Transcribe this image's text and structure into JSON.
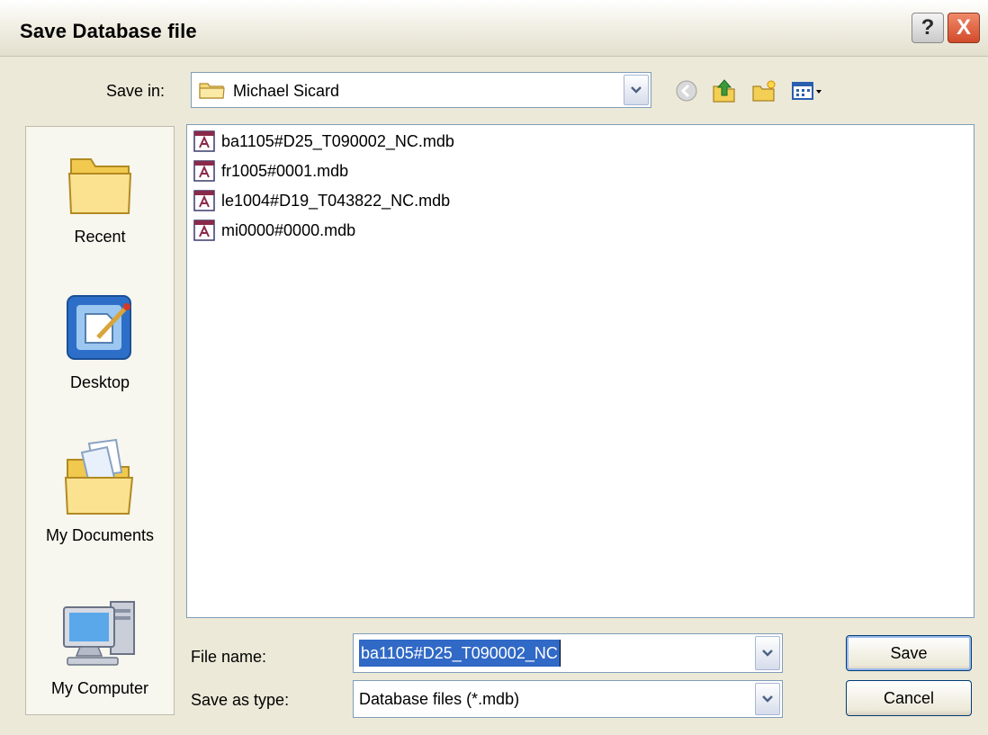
{
  "window": {
    "title": "Save Database file",
    "help_glyph": "?",
    "close_glyph": "X"
  },
  "save_in": {
    "label": "Save in:",
    "value": "Michael Sicard"
  },
  "toolbar": {
    "icons": [
      "back-icon",
      "up-folder-icon",
      "new-folder-icon",
      "views-menu-icon"
    ]
  },
  "places": [
    {
      "label": "Recent",
      "icon": "recent-folder-icon"
    },
    {
      "label": "Desktop",
      "icon": "desktop-icon"
    },
    {
      "label": "My Documents",
      "icon": "my-documents-icon"
    },
    {
      "label": "My Computer",
      "icon": "my-computer-icon"
    }
  ],
  "files": [
    {
      "name": "ba1105#D25_T090002_NC.mdb",
      "icon": "access-database-icon"
    },
    {
      "name": "fr1005#0001.mdb",
      "icon": "access-database-icon"
    },
    {
      "name": "le1004#D19_T043822_NC.mdb",
      "icon": "access-database-icon"
    },
    {
      "name": "mi0000#0000.mdb",
      "icon": "access-database-icon"
    }
  ],
  "file_name": {
    "label": "File name:",
    "value": "ba1105#D25_T090002_NC"
  },
  "save_as_type": {
    "label": "Save as type:",
    "value": "Database files (*.mdb)"
  },
  "buttons": {
    "save": "Save",
    "cancel": "Cancel"
  },
  "colors": {
    "dialog_bg": "#ece9d8",
    "selection": "#3169c6",
    "close_red": "#d24a2a"
  }
}
